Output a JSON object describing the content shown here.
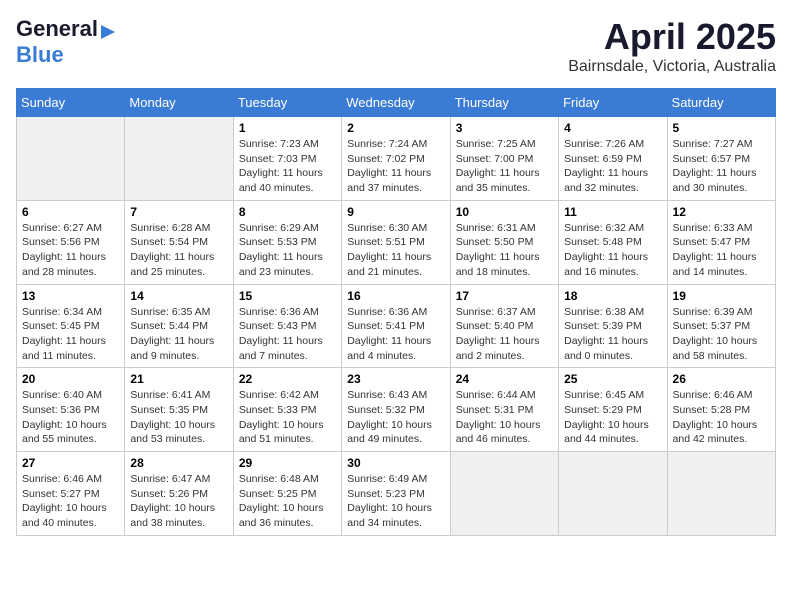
{
  "logo": {
    "general": "General",
    "blue": "Blue"
  },
  "title": "April 2025",
  "location": "Bairnsdale, Victoria, Australia",
  "days_header": [
    "Sunday",
    "Monday",
    "Tuesday",
    "Wednesday",
    "Thursday",
    "Friday",
    "Saturday"
  ],
  "weeks": [
    [
      {
        "day": "",
        "info": ""
      },
      {
        "day": "",
        "info": ""
      },
      {
        "day": "1",
        "info": "Sunrise: 7:23 AM\nSunset: 7:03 PM\nDaylight: 11 hours and 40 minutes."
      },
      {
        "day": "2",
        "info": "Sunrise: 7:24 AM\nSunset: 7:02 PM\nDaylight: 11 hours and 37 minutes."
      },
      {
        "day": "3",
        "info": "Sunrise: 7:25 AM\nSunset: 7:00 PM\nDaylight: 11 hours and 35 minutes."
      },
      {
        "day": "4",
        "info": "Sunrise: 7:26 AM\nSunset: 6:59 PM\nDaylight: 11 hours and 32 minutes."
      },
      {
        "day": "5",
        "info": "Sunrise: 7:27 AM\nSunset: 6:57 PM\nDaylight: 11 hours and 30 minutes."
      }
    ],
    [
      {
        "day": "6",
        "info": "Sunrise: 6:27 AM\nSunset: 5:56 PM\nDaylight: 11 hours and 28 minutes."
      },
      {
        "day": "7",
        "info": "Sunrise: 6:28 AM\nSunset: 5:54 PM\nDaylight: 11 hours and 25 minutes."
      },
      {
        "day": "8",
        "info": "Sunrise: 6:29 AM\nSunset: 5:53 PM\nDaylight: 11 hours and 23 minutes."
      },
      {
        "day": "9",
        "info": "Sunrise: 6:30 AM\nSunset: 5:51 PM\nDaylight: 11 hours and 21 minutes."
      },
      {
        "day": "10",
        "info": "Sunrise: 6:31 AM\nSunset: 5:50 PM\nDaylight: 11 hours and 18 minutes."
      },
      {
        "day": "11",
        "info": "Sunrise: 6:32 AM\nSunset: 5:48 PM\nDaylight: 11 hours and 16 minutes."
      },
      {
        "day": "12",
        "info": "Sunrise: 6:33 AM\nSunset: 5:47 PM\nDaylight: 11 hours and 14 minutes."
      }
    ],
    [
      {
        "day": "13",
        "info": "Sunrise: 6:34 AM\nSunset: 5:45 PM\nDaylight: 11 hours and 11 minutes."
      },
      {
        "day": "14",
        "info": "Sunrise: 6:35 AM\nSunset: 5:44 PM\nDaylight: 11 hours and 9 minutes."
      },
      {
        "day": "15",
        "info": "Sunrise: 6:36 AM\nSunset: 5:43 PM\nDaylight: 11 hours and 7 minutes."
      },
      {
        "day": "16",
        "info": "Sunrise: 6:36 AM\nSunset: 5:41 PM\nDaylight: 11 hours and 4 minutes."
      },
      {
        "day": "17",
        "info": "Sunrise: 6:37 AM\nSunset: 5:40 PM\nDaylight: 11 hours and 2 minutes."
      },
      {
        "day": "18",
        "info": "Sunrise: 6:38 AM\nSunset: 5:39 PM\nDaylight: 11 hours and 0 minutes."
      },
      {
        "day": "19",
        "info": "Sunrise: 6:39 AM\nSunset: 5:37 PM\nDaylight: 10 hours and 58 minutes."
      }
    ],
    [
      {
        "day": "20",
        "info": "Sunrise: 6:40 AM\nSunset: 5:36 PM\nDaylight: 10 hours and 55 minutes."
      },
      {
        "day": "21",
        "info": "Sunrise: 6:41 AM\nSunset: 5:35 PM\nDaylight: 10 hours and 53 minutes."
      },
      {
        "day": "22",
        "info": "Sunrise: 6:42 AM\nSunset: 5:33 PM\nDaylight: 10 hours and 51 minutes."
      },
      {
        "day": "23",
        "info": "Sunrise: 6:43 AM\nSunset: 5:32 PM\nDaylight: 10 hours and 49 minutes."
      },
      {
        "day": "24",
        "info": "Sunrise: 6:44 AM\nSunset: 5:31 PM\nDaylight: 10 hours and 46 minutes."
      },
      {
        "day": "25",
        "info": "Sunrise: 6:45 AM\nSunset: 5:29 PM\nDaylight: 10 hours and 44 minutes."
      },
      {
        "day": "26",
        "info": "Sunrise: 6:46 AM\nSunset: 5:28 PM\nDaylight: 10 hours and 42 minutes."
      }
    ],
    [
      {
        "day": "27",
        "info": "Sunrise: 6:46 AM\nSunset: 5:27 PM\nDaylight: 10 hours and 40 minutes."
      },
      {
        "day": "28",
        "info": "Sunrise: 6:47 AM\nSunset: 5:26 PM\nDaylight: 10 hours and 38 minutes."
      },
      {
        "day": "29",
        "info": "Sunrise: 6:48 AM\nSunset: 5:25 PM\nDaylight: 10 hours and 36 minutes."
      },
      {
        "day": "30",
        "info": "Sunrise: 6:49 AM\nSunset: 5:23 PM\nDaylight: 10 hours and 34 minutes."
      },
      {
        "day": "",
        "info": ""
      },
      {
        "day": "",
        "info": ""
      },
      {
        "day": "",
        "info": ""
      }
    ]
  ]
}
